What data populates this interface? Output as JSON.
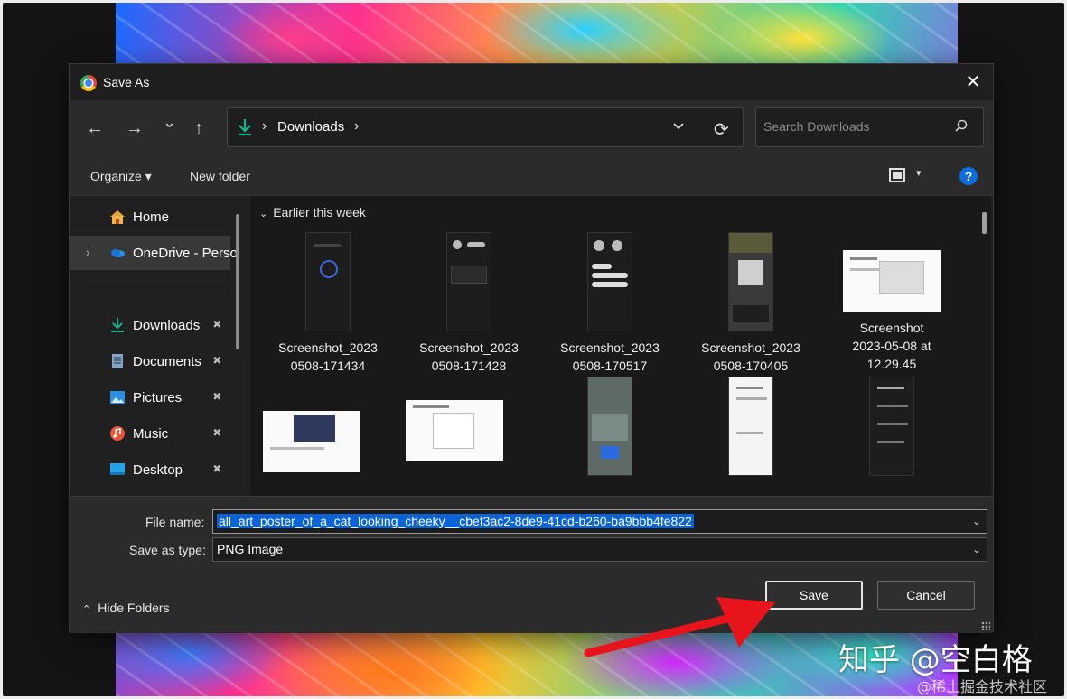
{
  "dialog": {
    "title": "Save As",
    "close_glyph": "✕"
  },
  "nav": {
    "back_glyph": "←",
    "forward_glyph": "→",
    "recent_glyph": "⌄",
    "up_glyph": "↑",
    "address_path": "Downloads",
    "address_sep": "›",
    "refresh_glyph": "⟳",
    "search_placeholder": "Search Downloads"
  },
  "toolbar": {
    "organize": "Organize ▾",
    "new_folder": "New folder",
    "view_caret": "▾",
    "help": "?"
  },
  "sidebar": {
    "items": [
      {
        "label": "Home",
        "icon": "home-icon"
      },
      {
        "label": "OneDrive - Perso",
        "icon": "onedrive-icon"
      },
      {
        "label": "Downloads",
        "icon": "download-icon"
      },
      {
        "label": "Documents",
        "icon": "documents-icon"
      },
      {
        "label": "Pictures",
        "icon": "pictures-icon"
      },
      {
        "label": "Music",
        "icon": "music-icon"
      },
      {
        "label": "Desktop",
        "icon": "desktop-icon"
      }
    ],
    "pin_glyph": "📌",
    "expand_glyph": "›"
  },
  "files": {
    "group": "Earlier this week",
    "group_glyph": "⌄",
    "items": [
      {
        "name_line1": "Screenshot_2023",
        "name_line2": "0508-171434",
        "name_line3": ""
      },
      {
        "name_line1": "Screenshot_2023",
        "name_line2": "0508-171428",
        "name_line3": ""
      },
      {
        "name_line1": "Screenshot_2023",
        "name_line2": "0508-170517",
        "name_line3": ""
      },
      {
        "name_line1": "Screenshot_2023",
        "name_line2": "0508-170405",
        "name_line3": ""
      },
      {
        "name_line1": "Screenshot",
        "name_line2": "2023-05-08 at",
        "name_line3": "12.29.45"
      }
    ]
  },
  "form": {
    "file_name_label": "File name:",
    "file_name_value": "all_art_poster_of_a_cat_looking_cheeky__cbef3ac2-8de9-41cd-b260-ba9bbb4fe822",
    "save_type_label": "Save as type:",
    "save_type_value": "PNG Image",
    "dropdown_glyph": "⌄"
  },
  "footer": {
    "hide_folders": "Hide Folders",
    "hide_glyph": "⌃",
    "save": "Save",
    "cancel": "Cancel"
  },
  "watermark": {
    "main": "知乎 @空白格",
    "sub": "@稀土掘金技术社区"
  },
  "colors": {
    "accent": "#0a64d8",
    "arrow": "#e8141b"
  }
}
